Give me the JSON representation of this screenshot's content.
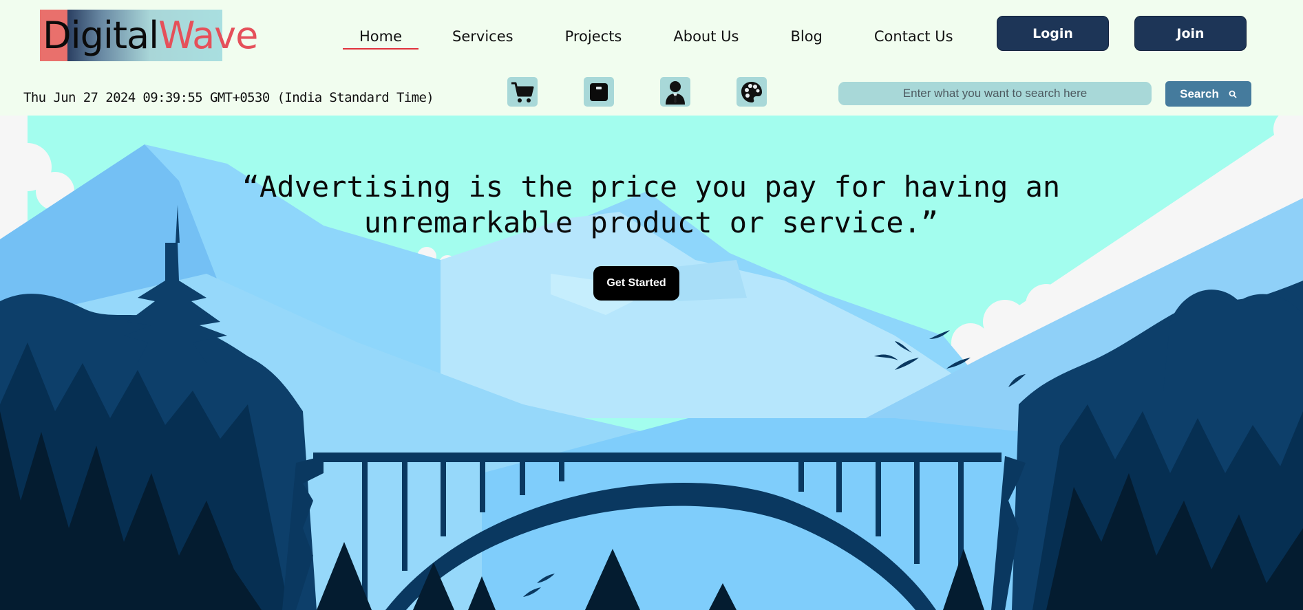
{
  "logo": {
    "part1": "Digital",
    "part2": "Wave"
  },
  "nav": {
    "items": [
      {
        "label": "Home"
      },
      {
        "label": "Services"
      },
      {
        "label": "Projects"
      },
      {
        "label": "About Us"
      },
      {
        "label": "Blog"
      },
      {
        "label": "Contact Us"
      }
    ],
    "active": "Home"
  },
  "auth": {
    "login_label": "Login",
    "join_label": "Join"
  },
  "datetime": "Thu Jun 27 2024 09:39:55 GMT+0530 (India Standard Time)",
  "quick_icons": [
    "cart-icon",
    "box-icon",
    "user-icon",
    "palette-icon"
  ],
  "search": {
    "placeholder": "Enter what you want to search here",
    "button_label": "Search",
    "icon": "search-icon"
  },
  "hero": {
    "quote": "“Advertising is the price you pay for having an unremarkable product or service.”",
    "cta_label": "Get Started"
  },
  "colors": {
    "header_bg": "#f1fdef",
    "nav_dark": "#1d3557",
    "search_bg": "#a8d8d8",
    "search_btn": "#457b9d",
    "sky": "#a3fdee",
    "nav_underline": "#e0313a"
  }
}
